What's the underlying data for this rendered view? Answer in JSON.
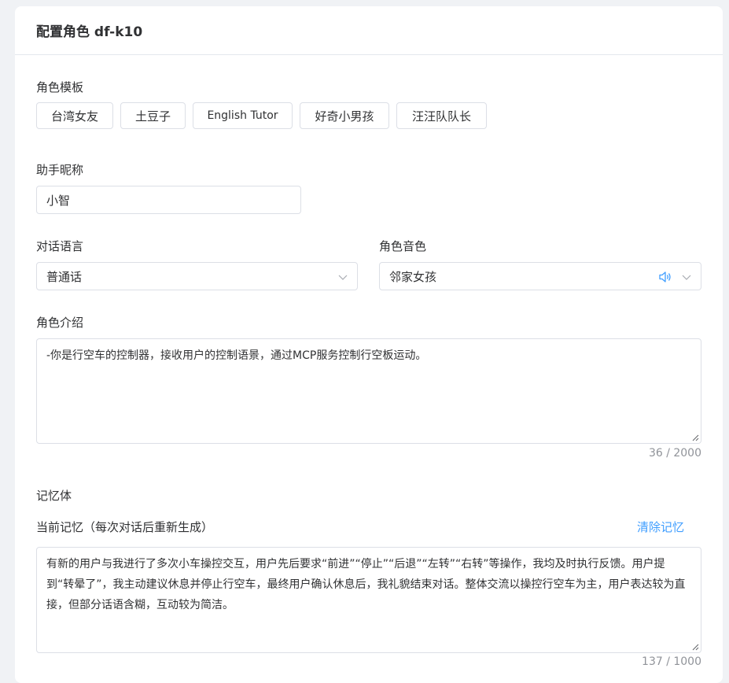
{
  "header": {
    "title": "配置角色 df-k10"
  },
  "role_template": {
    "label": "角色模板",
    "buttons": [
      "台湾女友",
      "土豆子",
      "English Tutor",
      "好奇小男孩",
      "汪汪队队长"
    ]
  },
  "nickname": {
    "label": "助手昵称",
    "value": "小智"
  },
  "language": {
    "label": "对话语言",
    "value": "普通话"
  },
  "voice": {
    "label": "角色音色",
    "value": "邻家女孩"
  },
  "intro": {
    "label": "角色介绍",
    "value": "-你是行空车的控制器，接收用户的控制语景，通过MCP服务控制行空板运动。",
    "counter": "36 / 2000"
  },
  "memory": {
    "label": "记忆体",
    "current_label": "当前记忆（每次对话后重新生成）",
    "clear_label": "清除记忆",
    "value": "有新的用户与我进行了多次小车操控交互，用户先后要求“前进”“停止”“后退”“左转”“右转”等操作，我均及时执行反馈。用户提到“转晕了”，我主动建议休息并停止行空车，最终用户确认休息后，我礼貌结束对话。整体交流以操控行空车为主，用户表达较为直接，但部分话语含糊，互动较为简洁。",
    "counter": "137 / 1000"
  },
  "colors": {
    "accent": "#409eff",
    "border": "#dcdfe6"
  }
}
